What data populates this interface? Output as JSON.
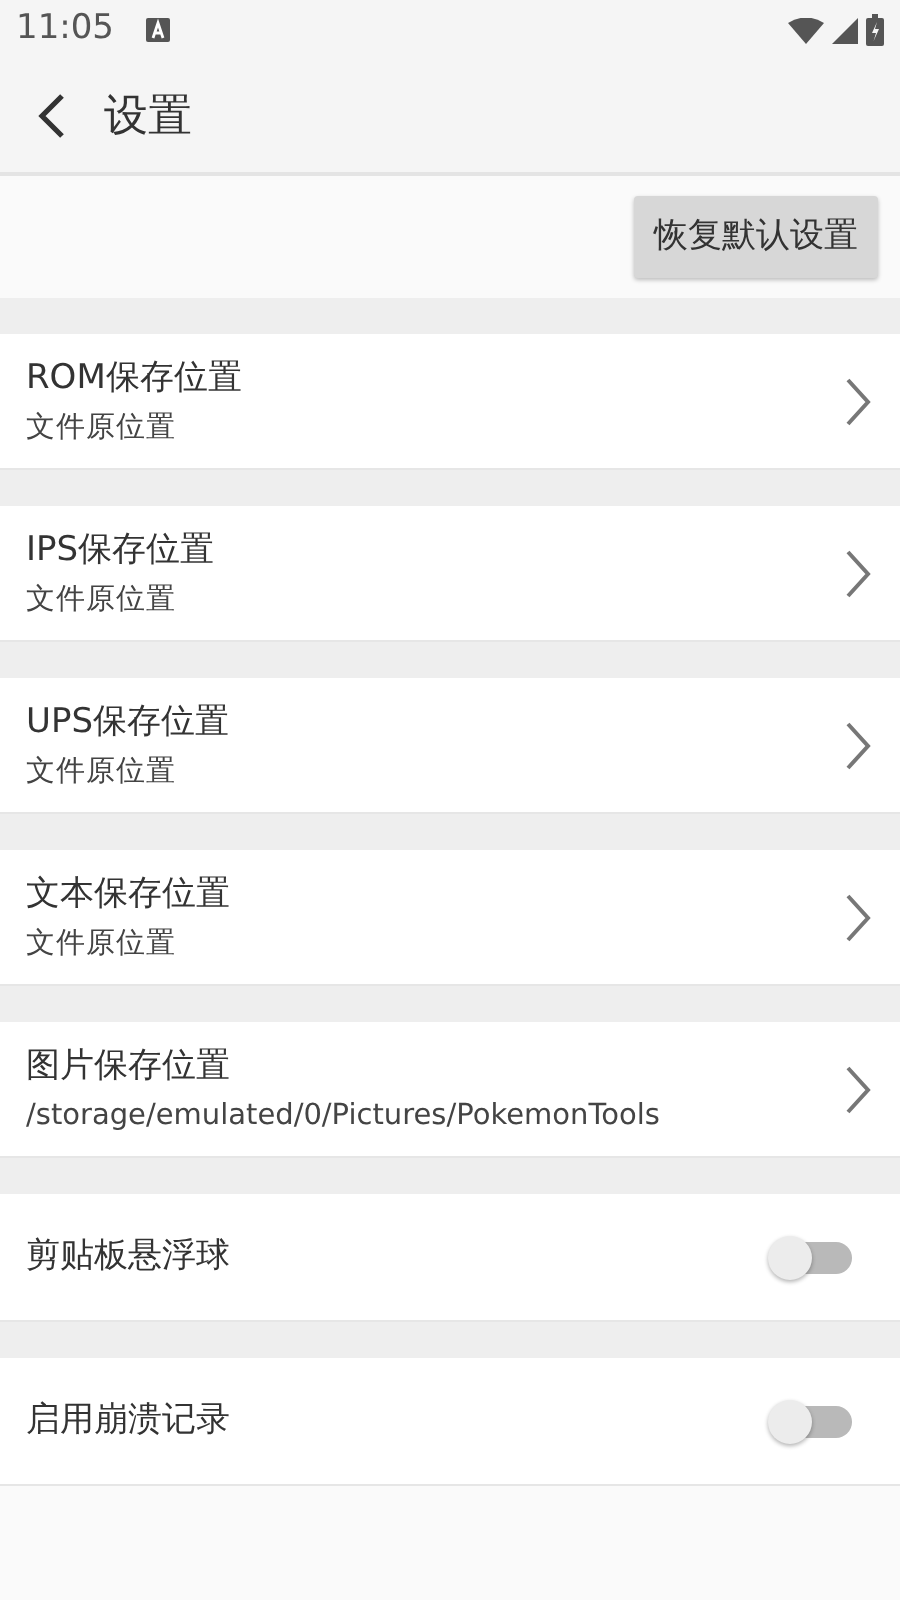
{
  "status_bar": {
    "time": "11:05"
  },
  "app_bar": {
    "title": "设置"
  },
  "reset_button": {
    "label": "恢复默认设置"
  },
  "settings": [
    {
      "kind": "link",
      "title": "ROM保存位置",
      "value": "文件原位置"
    },
    {
      "kind": "link",
      "title": "IPS保存位置",
      "value": "文件原位置"
    },
    {
      "kind": "link",
      "title": "UPS保存位置",
      "value": "文件原位置"
    },
    {
      "kind": "link",
      "title": "文本保存位置",
      "value": "文件原位置"
    },
    {
      "kind": "link",
      "title": "图片保存位置",
      "value": "/storage/emulated/0/Pictures/PokemonTools"
    },
    {
      "kind": "toggle",
      "title": "剪贴板悬浮球",
      "on": false
    },
    {
      "kind": "toggle",
      "title": "启用崩溃记录",
      "on": false
    }
  ]
}
